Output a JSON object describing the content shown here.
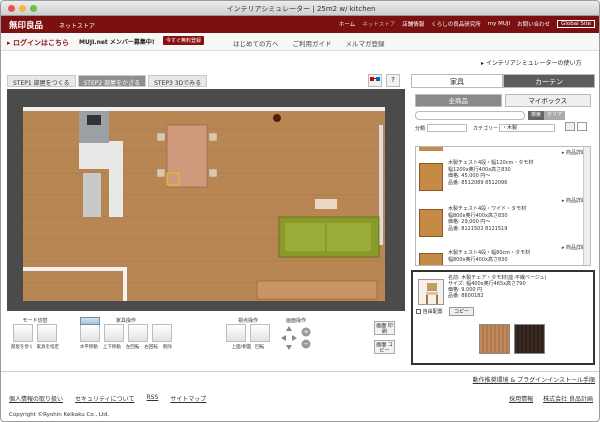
{
  "window": {
    "title": "インテリアシミュレーター | 25m2 w/ kitchen"
  },
  "header": {
    "logo": "無印良品",
    "logo_sub": "ネットストア",
    "nav": [
      "ホーム",
      "ネットストア",
      "店舗情報",
      "くらしの良品研究所",
      "my MUJI",
      "お問い合わせ"
    ],
    "global_site": "Global Site"
  },
  "subbar": {
    "login": "ログインはこちら",
    "campaign": "MUJI.net メンバー募集中!",
    "register": "今すぐ無料登録",
    "links": [
      "はじめての方へ",
      "ご利用ガイド",
      "メルマガ登録"
    ]
  },
  "howto": "インテリアシミュレーターの使い方",
  "steps": [
    {
      "label": "STEP1 部屋をつくる",
      "active": false
    },
    {
      "label": "STEP2 部屋をかざる",
      "active": true
    },
    {
      "label": "STEP3 3Dでみる",
      "active": false
    }
  ],
  "view_buttons": {
    "threed": "3D",
    "help": "?"
  },
  "controls": {
    "mode_title": "モード切替",
    "mode_buttons": [
      "部屋を歩く",
      "家具を指定"
    ],
    "furniture_title": "家具操作",
    "furniture_buttons": [
      "水平移動",
      "上下移動",
      "左回転",
      "右回転",
      "削除"
    ],
    "view_title": "視点操作",
    "view_buttons": [
      "上面/側面",
      "回転"
    ],
    "screen_title": "画面操作",
    "right_buttons": [
      "画面\n印刷",
      "画面\nコピー"
    ]
  },
  "panel": {
    "tabs": [
      {
        "label": "家具",
        "active": true
      },
      {
        "label": "カーテン",
        "active": false
      }
    ],
    "subtabs": [
      {
        "label": "全商品",
        "active": true
      },
      {
        "label": "マイボックス",
        "active": false
      }
    ],
    "search_btn": "検索",
    "clear_btn": "クリア",
    "filter_label1": "分類",
    "filter_label2": "カテゴリー",
    "filter_value2": "・木製",
    "detail": "商品詳細",
    "items": [
      {
        "name": "木製チェスト4段・幅120cm・タモ材",
        "size": "幅1200x奥行400x高さ830",
        "price": "価格: 45,000 円〜",
        "code": "品番: 8512089 8512096"
      },
      {
        "name": "木製チェスト4段・ワイド・タモ材",
        "size": "幅800x奥行400x高さ830",
        "price": "価格: 29,000 円〜",
        "code": "品番: 8121502 8121519"
      },
      {
        "name": "木製チェスト4段・幅80cm・タモ材",
        "size": "幅800x奥行400x高さ830",
        "price": "",
        "code": ""
      }
    ],
    "selected": {
      "name": "名前: 木製チェア・タモ材(座:平織ベージュ)",
      "size": "サイズ: 幅400x奥行465x高さ790",
      "price": "価格: 9,000 円",
      "code": "品番: 8600182",
      "check_label": "自由配置",
      "copy_btn": "コピー"
    }
  },
  "footer": {
    "install": "動作推奨環境 & プラグインインストール手順",
    "links": [
      "個人情報の取り扱い",
      "セキュリティについて",
      "RSS",
      "サイトマップ"
    ],
    "right_links": [
      "採用情報",
      "株式会社 良品計画"
    ],
    "copyright": "Copyright ©Ryohin Keikaku Co., Ltd."
  },
  "colors": {
    "brand": "#7a1010",
    "floor": "#b8834e",
    "sofa": "#8a9a2a"
  }
}
